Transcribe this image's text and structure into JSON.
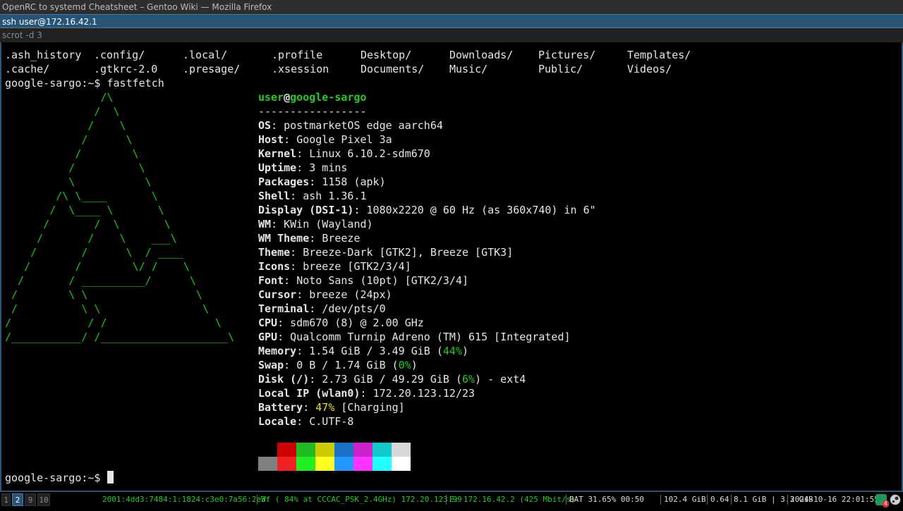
{
  "window": {
    "title": "OpenRC to systemd Cheatsheet – Gentoo Wiki — Mozilla Firefox",
    "active_title": "ssh user@172.16.42.1",
    "inactive_title": "scrot -d 3"
  },
  "terminal": {
    "ls_output": [
      [
        ".ash_history",
        ".config/",
        ".local/",
        ".profile",
        "Desktop/",
        "Downloads/",
        "Pictures/",
        "Templates/"
      ],
      [
        ".cache/",
        ".gtkrc-2.0",
        ".presage/",
        ".xsession",
        "Documents/",
        "Music/",
        "Public/",
        "Videos/"
      ]
    ],
    "prompt": "google-sargo:~$ ",
    "command": "fastfetch",
    "ascii_art": [
      "               /\\",
      "              /  \\",
      "             /    \\",
      "            /      \\",
      "           /        \\",
      "          /          \\",
      "          \\           \\",
      "        /\\ \\____       \\",
      "       /  \\____ \\       \\",
      "      /       /  \\       \\",
      "     /       /    \\    ___\\",
      "    /       /      \\  / ____",
      "   /       /        \\/ /    \\",
      "  /       / __________/      \\",
      " /        \\ \\                 \\",
      " /          \\ \\                \\",
      "/            / /                 \\",
      "/___________/ /____________________\\"
    ],
    "fetch": {
      "user": "user",
      "at": "@",
      "host": "google-sargo",
      "divider": "-----------------",
      "fields": [
        {
          "key": "OS",
          "value": "postmarketOS edge aarch64"
        },
        {
          "key": "Host",
          "value": "Google Pixel 3a"
        },
        {
          "key": "Kernel",
          "value": "Linux 6.10.2-sdm670"
        },
        {
          "key": "Uptime",
          "value": "3 mins"
        },
        {
          "key": "Packages",
          "value": "1158 (apk)"
        },
        {
          "key": "Shell",
          "value": "ash 1.36.1"
        },
        {
          "key": "Display (DSI-1)",
          "value": "1080x2220 @ 60 Hz (as 360x740) in 6\""
        },
        {
          "key": "WM",
          "value": "KWin (Wayland)"
        },
        {
          "key": "WM Theme",
          "value": "Breeze"
        },
        {
          "key": "Theme",
          "value": "Breeze-Dark [GTK2], Breeze [GTK3]"
        },
        {
          "key": "Icons",
          "value": "breeze [GTK2/3/4]"
        },
        {
          "key": "Font",
          "value": "Noto Sans (10pt) [GTK2/3/4]"
        },
        {
          "key": "Cursor",
          "value": "breeze (24px)"
        },
        {
          "key": "Terminal",
          "value": "/dev/pts/0"
        },
        {
          "key": "CPU",
          "value": "sdm670 (8) @ 2.00 GHz"
        },
        {
          "key": "GPU",
          "value": "Qualcomm Turnip Adreno (TM) 615 [Integrated]"
        }
      ],
      "memory": {
        "key": "Memory",
        "pre": "1.54 GiB / 3.49 GiB (",
        "pct": "44%",
        "post": ")"
      },
      "swap": {
        "key": "Swap",
        "pre": "0 B / 1.74 GiB (",
        "pct": "0%",
        "post": ")"
      },
      "disk": {
        "key": "Disk (/)",
        "pre": "2.73 GiB / 49.29 GiB (",
        "pct": "6%",
        "post": ") - ext4"
      },
      "localip": {
        "key": "Local IP (wlan0)",
        "value": "172.20.123.12/23"
      },
      "battery": {
        "key": "Battery",
        "pct": "47%",
        "post": " [Charging]"
      },
      "locale": {
        "key": "Locale",
        "value": "C.UTF-8"
      },
      "palette_top": [
        "#000000",
        "#cc0000",
        "#22bb22",
        "#cccc00",
        "#1a72c8",
        "#cc22cc",
        "#11cccc",
        "#d8d8d8"
      ],
      "palette_bottom": [
        "#808080",
        "#ee2222",
        "#22ee22",
        "#ffff22",
        "#2299ff",
        "#ff33ff",
        "#22ffff",
        "#ffffff"
      ]
    },
    "final_prompt": "google-sargo:~$ "
  },
  "statusbar": {
    "workspaces": [
      {
        "label": "1",
        "active": false
      },
      {
        "label": "2",
        "active": true
      },
      {
        "label": "9",
        "active": false
      },
      {
        "label": "10",
        "active": false
      }
    ],
    "ipv6": "2001:4dd3:7484:1:1824:c3e0:7a56:2e3f",
    "wifi": "W: ( 84% at CCCAC_PSK_2.4GHz) 172.20.123.99",
    "ethernet": "E: 172.16.42.2 (425 Mbit/s)",
    "battery": "BAT 31.65% 00:50",
    "disk": "102.4 GiB",
    "load": "0.64",
    "memory": "8.1 GiB | 3.3 GiB",
    "datetime": "2024-10-16 22:01:55",
    "tray_badge": "4",
    "colors": {
      "ipv6": "#22cc22",
      "wifi": "#22cc22",
      "ethernet": "#22cc22",
      "default": "#dddddd"
    }
  }
}
